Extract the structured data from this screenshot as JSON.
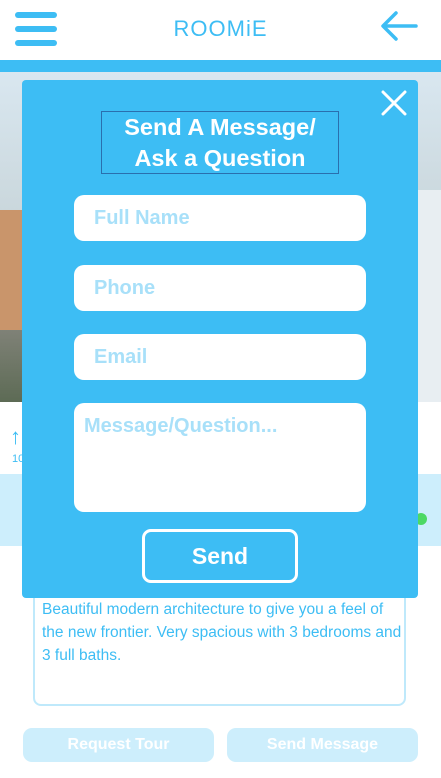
{
  "header": {
    "logo": "ROOMiE",
    "menu_icon": "hamburger-menu-icon",
    "back_icon": "arrow-left-icon"
  },
  "background": {
    "stat_icon": "arrow-up-icon",
    "stat_value": "10",
    "description": "Beautiful modern architecture to give you a feel of the new frontier. Very spacious with 3 bedrooms and 3 full baths.",
    "request_tour_label": "Request Tour",
    "send_message_label": "Send Message"
  },
  "modal": {
    "title_line1": "Send A Message/",
    "title_line2": "Ask a Question",
    "close_icon": "close-icon",
    "full_name_placeholder": "Full Name",
    "phone_placeholder": "Phone",
    "email_placeholder": "Email",
    "message_placeholder": "Message/Question...",
    "send_label": "Send"
  },
  "colors": {
    "accent": "#3dbdf4",
    "light_accent": "#cdeefc",
    "white": "#ffffff",
    "online": "#4cd964"
  }
}
